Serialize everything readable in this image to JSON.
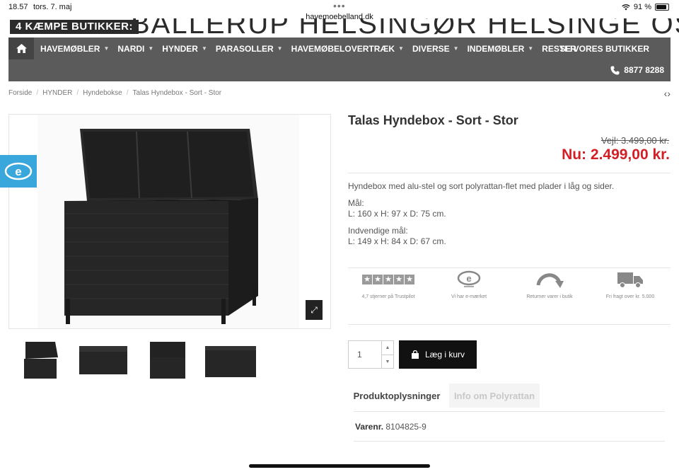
{
  "status_bar": {
    "time": "18.57",
    "date": "tors. 7. maj",
    "url": "havemoebelland.dk",
    "battery": "91 %"
  },
  "banner": {
    "tag": "4 KÆMPE BUTIKKER:",
    "cities": "BALLERUP   HELSINGØR   HELSINGE   OSTED"
  },
  "nav": {
    "items": [
      {
        "label": "HAVEMØBLER",
        "dropdown": true
      },
      {
        "label": "NARDI",
        "dropdown": true
      },
      {
        "label": "HYNDER",
        "dropdown": true
      },
      {
        "label": "PARASOLLER",
        "dropdown": true
      },
      {
        "label": "HAVEMØBELOVERTRÆK",
        "dropdown": true
      },
      {
        "label": "DIVERSE",
        "dropdown": true
      },
      {
        "label": "INDEMØBLER",
        "dropdown": true
      },
      {
        "label": "RESTER",
        "dropdown": false
      }
    ],
    "shops": "SE VORES BUTIKKER",
    "phone": "8877 8288"
  },
  "breadcrumb": [
    "Forside",
    "HYNDER",
    "Hyndebokse",
    "Talas Hyndebox - Sort - Stor"
  ],
  "product": {
    "title": "Talas Hyndebox - Sort - Stor",
    "old_price": "Vejl: 3.499,00 kr.",
    "price": "Nu: 2.499,00 kr.",
    "description": "Hyndebox med alu-stel og sort polyrattan-flet med plader i låg og sider.",
    "dims_label": "Mål:",
    "dims": "L: 160 x H: 97 x D: 75 cm.",
    "inner_label": "Indvendige mål:",
    "inner": "L: 149 x H: 84 x D: 67 cm."
  },
  "trust": [
    {
      "icon": "trustpilot-stars-icon",
      "label": "4,7 stjerner på Trustpilot"
    },
    {
      "icon": "e-maerket-icon",
      "label": "Vi har e-mærket"
    },
    {
      "icon": "return-arrow-icon",
      "label": "Returner varer i butik"
    },
    {
      "icon": "truck-icon",
      "label": "Fri fragt over kr. 5.000"
    }
  ],
  "cart": {
    "quantity": "1",
    "button": "Læg i kurv"
  },
  "tabs": {
    "active": "Produktoplysninger",
    "inactive": "Info om Polyrattan"
  },
  "details": {
    "varenr_label": "Varenr.",
    "varenr": "8104825-9"
  },
  "colors": {
    "nav_bg": "#5b5b5b",
    "price_red": "#d21f26",
    "emark_blue": "#3aa7dc"
  }
}
